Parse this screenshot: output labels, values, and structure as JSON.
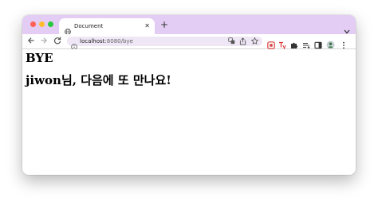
{
  "browser": {
    "tab_title": "Document",
    "new_tab_symbol": "+",
    "tab_close_symbol": "✕",
    "url_host": "localhost",
    "url_rest": ":8080/bye",
    "icons": [
      "globe-icon",
      "tab-close-icon",
      "new-tab-icon",
      "tab-search-chevron-icon",
      "back-icon",
      "forward-icon",
      "reload-icon",
      "info-icon",
      "translate-icon",
      "share-icon",
      "bookmark-star-icon",
      "extension-icons",
      "puzzle-icon",
      "reading-list-icon",
      "side-panel-icon",
      "profile-avatar-icon",
      "menu-kebab-icon"
    ]
  },
  "page": {
    "heading": "BYE",
    "message": "jiwon님, 다음에 또 만나요!"
  },
  "colors": {
    "tabbar": "#e3cdf4",
    "omnibox": "#efe7f6",
    "close": "#fe5f57",
    "minimize": "#febc2e",
    "maximize": "#28c840"
  }
}
